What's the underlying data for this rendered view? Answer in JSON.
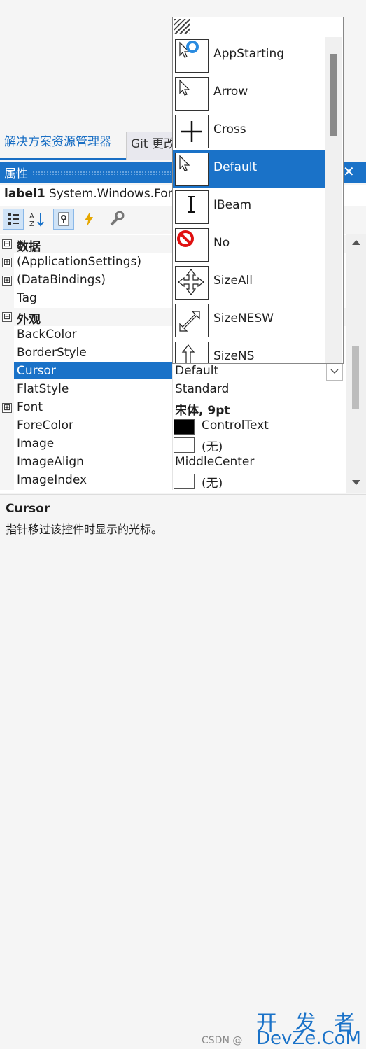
{
  "tabs": [
    {
      "label": "解决方案资源管理器"
    },
    {
      "label": "Git 更改"
    }
  ],
  "panel": {
    "title": "属性",
    "close_glyph": "✕"
  },
  "object_selector": {
    "name": "label1",
    "type": "System.Windows.Forms.Label"
  },
  "toolbar": {
    "categorized": "categorized-icon",
    "alphabetical": "alphabetical-icon",
    "properties": "properties-icon",
    "events": "events-icon",
    "property_pages": "property-pages-icon"
  },
  "grid": {
    "rows": [
      {
        "kind": "category",
        "name": "数据",
        "expander": "⊟"
      },
      {
        "kind": "prop",
        "name": "(ApplicationSettings)",
        "expander": "⊞",
        "value": ""
      },
      {
        "kind": "prop",
        "name": "(DataBindings)",
        "expander": "⊞",
        "value": ""
      },
      {
        "kind": "prop",
        "name": "Tag",
        "value": ""
      },
      {
        "kind": "category",
        "name": "外观",
        "expander": "⊟"
      },
      {
        "kind": "prop",
        "name": "BackColor",
        "value": ""
      },
      {
        "kind": "prop",
        "name": "BorderStyle",
        "value": ""
      },
      {
        "kind": "prop",
        "name": "Cursor",
        "value": "Default",
        "selected": true
      },
      {
        "kind": "prop",
        "name": "FlatStyle",
        "value": "Standard"
      },
      {
        "kind": "prop",
        "name": "Font",
        "expander": "⊞",
        "value": "宋体, 9pt",
        "bold": true
      },
      {
        "kind": "prop",
        "name": "ForeColor",
        "value": "ControlText",
        "swatch": "#000000"
      },
      {
        "kind": "prop",
        "name": "Image",
        "value": "(无)",
        "swatch": "#ffffff"
      },
      {
        "kind": "prop",
        "name": "ImageAlign",
        "value": "MiddleCenter"
      },
      {
        "kind": "prop",
        "name": "ImageIndex",
        "value": "(无)",
        "swatch": "#ffffff"
      }
    ]
  },
  "dropdown": {
    "items": [
      "AppStarting",
      "Arrow",
      "Cross",
      "Default",
      "IBeam",
      "No",
      "SizeAll",
      "SizeNESW",
      "SizeNS"
    ],
    "selected": "Default"
  },
  "description": {
    "title": "Cursor",
    "text": "指针移过该控件时显示的光标。"
  },
  "watermark": {
    "line1": "开 发 者",
    "line2": "DevZe.CoM",
    "line3": "CSDN @"
  },
  "colors": {
    "accent": "#1a72c8"
  }
}
